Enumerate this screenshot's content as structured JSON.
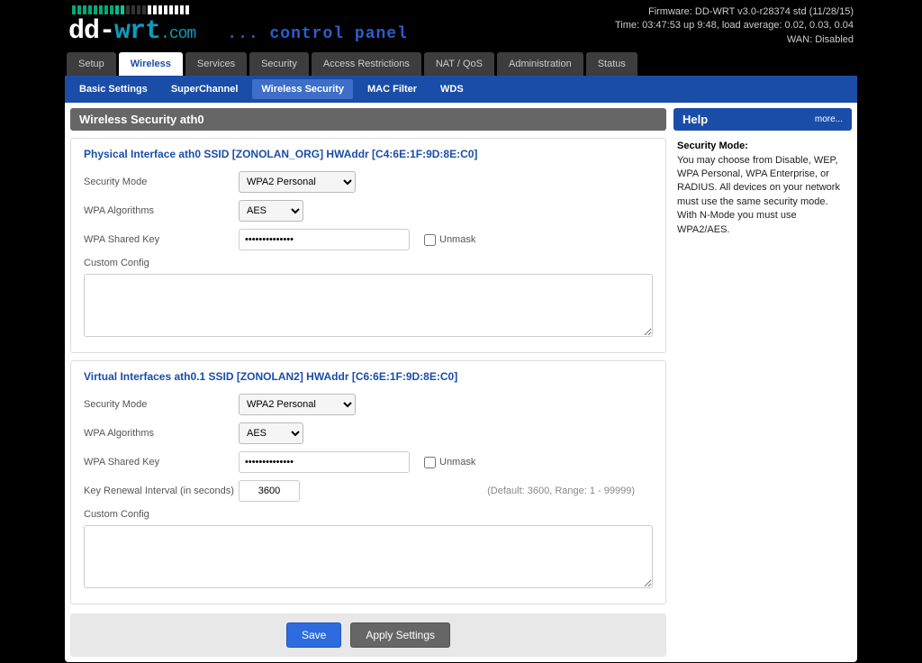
{
  "header": {
    "logo_dd": "dd-",
    "logo_wrt": "wrt",
    "logo_com": ".com",
    "control_panel": "... control panel",
    "firmware": "Firmware: DD-WRT v3.0-r28374 std (11/28/15)",
    "time": "Time: 03:47:53 up 9:48, load average: 0.02, 0.03, 0.04",
    "wan": "WAN: Disabled"
  },
  "tabs": {
    "main": [
      "Setup",
      "Wireless",
      "Services",
      "Security",
      "Access Restrictions",
      "NAT / QoS",
      "Administration",
      "Status"
    ],
    "main_active": 1,
    "sub": [
      "Basic Settings",
      "SuperChannel",
      "Wireless Security",
      "MAC Filter",
      "WDS"
    ],
    "sub_active": 2
  },
  "section_title": "Wireless Security ath0",
  "iface0": {
    "title": "Physical Interface ath0 SSID [ZONOLAN_ORG] HWAddr [C4:6E:1F:9D:8E:C0]",
    "security_mode_label": "Security Mode",
    "security_mode_value": "WPA2 Personal",
    "wpa_alg_label": "WPA Algorithms",
    "wpa_alg_value": "AES",
    "wpa_key_label": "WPA Shared Key",
    "wpa_key_value": "••••••••••••••",
    "unmask_label": "Unmask",
    "custom_config_label": "Custom Config",
    "custom_config_value": ""
  },
  "iface1": {
    "title": "Virtual Interfaces ath0.1 SSID [ZONOLAN2] HWAddr [C6:6E:1F:9D:8E:C0]",
    "security_mode_label": "Security Mode",
    "security_mode_value": "WPA2 Personal",
    "wpa_alg_label": "WPA Algorithms",
    "wpa_alg_value": "AES",
    "wpa_key_label": "WPA Shared Key",
    "wpa_key_value": "••••••••••••••",
    "unmask_label": "Unmask",
    "key_renewal_label": "Key Renewal Interval (in seconds)",
    "key_renewal_value": "3600",
    "key_renewal_hint": "(Default: 3600, Range: 1 - 99999)",
    "custom_config_label": "Custom Config",
    "custom_config_value": ""
  },
  "buttons": {
    "save": "Save",
    "apply": "Apply Settings"
  },
  "help": {
    "title": "Help",
    "more": "more...",
    "heading": "Security Mode:",
    "body": "You may choose from Disable, WEP, WPA Personal, WPA Enterprise, or RADIUS. All devices on your network must use the same security mode. With N-Mode you must use WPA2/AES."
  },
  "indicator_colors": [
    "#0a7",
    "#0a7",
    "#0a7",
    "#0a7",
    "#0a7",
    "#0a7",
    "#0a7",
    "#0a7",
    "#0b9",
    "#0c9",
    "#333",
    "#333",
    "#333",
    "#333",
    "#fff",
    "#fff",
    "#fff",
    "#fff",
    "#fff",
    "#fff",
    "#fff",
    "#fff"
  ]
}
